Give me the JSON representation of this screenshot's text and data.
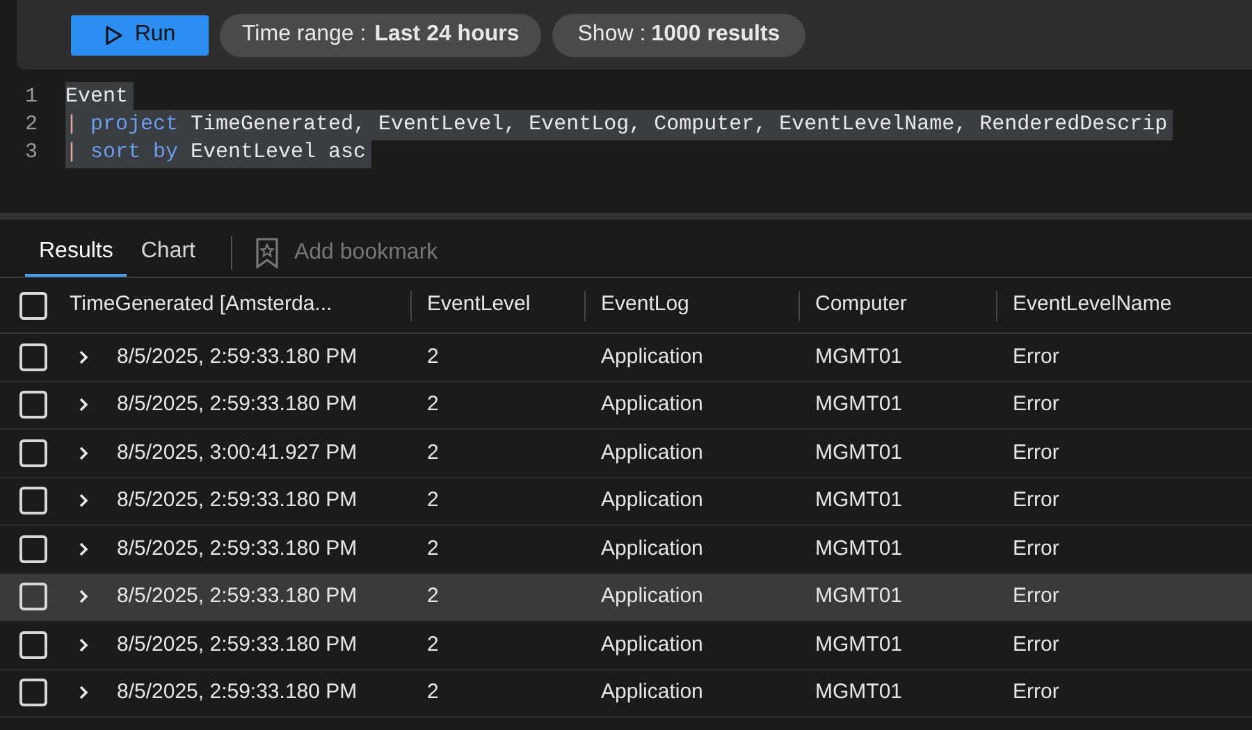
{
  "toolbar": {
    "run_button": "Run",
    "time_range": {
      "label": "Time range :",
      "value": "Last 24 hours"
    },
    "show": {
      "label": "Show :",
      "value": "1000 results"
    }
  },
  "editor": {
    "lines": [
      {
        "number": "1",
        "tokens": [
          {
            "kind": "plain",
            "text": "Event"
          }
        ]
      },
      {
        "number": "2",
        "tokens": [
          {
            "kind": "pipe",
            "text": "|"
          },
          {
            "kind": "keyword",
            "text": "project"
          },
          {
            "kind": "plain",
            "text": "TimeGenerated, EventLevel, EventLog, Computer, EventLevelName, RenderedDescrip"
          }
        ]
      },
      {
        "number": "3",
        "tokens": [
          {
            "kind": "pipe",
            "text": "|"
          },
          {
            "kind": "keyword",
            "text": "sort by"
          },
          {
            "kind": "plain",
            "text": "EventLevel asc"
          }
        ]
      }
    ]
  },
  "tabs": [
    {
      "label": "Results",
      "selected": true
    },
    {
      "label": "Chart",
      "selected": false
    }
  ],
  "add_bookmark": {
    "label": "Add bookmark",
    "disabled": true
  },
  "table": {
    "select_all_checked": false,
    "columns": [
      "TimeGenerated [Amsterda...",
      "EventLevel",
      "EventLog",
      "Computer",
      "EventLevelName"
    ],
    "rows": [
      {
        "highlighted": false,
        "checked": false,
        "cells": [
          "8/5/2025, 2:59:33.180 PM",
          "2",
          "Application",
          "MGMT01",
          "Error"
        ]
      },
      {
        "highlighted": false,
        "checked": false,
        "cells": [
          "8/5/2025, 2:59:33.180 PM",
          "2",
          "Application",
          "MGMT01",
          "Error"
        ]
      },
      {
        "highlighted": false,
        "checked": false,
        "cells": [
          "8/5/2025, 3:00:41.927 PM",
          "2",
          "Application",
          "MGMT01",
          "Error"
        ]
      },
      {
        "highlighted": false,
        "checked": false,
        "cells": [
          "8/5/2025, 2:59:33.180 PM",
          "2",
          "Application",
          "MGMT01",
          "Error"
        ]
      },
      {
        "highlighted": false,
        "checked": false,
        "cells": [
          "8/5/2025, 2:59:33.180 PM",
          "2",
          "Application",
          "MGMT01",
          "Error"
        ]
      },
      {
        "highlighted": true,
        "checked": false,
        "cells": [
          "8/5/2025, 2:59:33.180 PM",
          "2",
          "Application",
          "MGMT01",
          "Error"
        ]
      },
      {
        "highlighted": false,
        "checked": false,
        "cells": [
          "8/5/2025, 2:59:33.180 PM",
          "2",
          "Application",
          "MGMT01",
          "Error"
        ]
      },
      {
        "highlighted": false,
        "checked": false,
        "cells": [
          "8/5/2025, 2:59:33.180 PM",
          "2",
          "Application",
          "MGMT01",
          "Error"
        ]
      }
    ]
  }
}
